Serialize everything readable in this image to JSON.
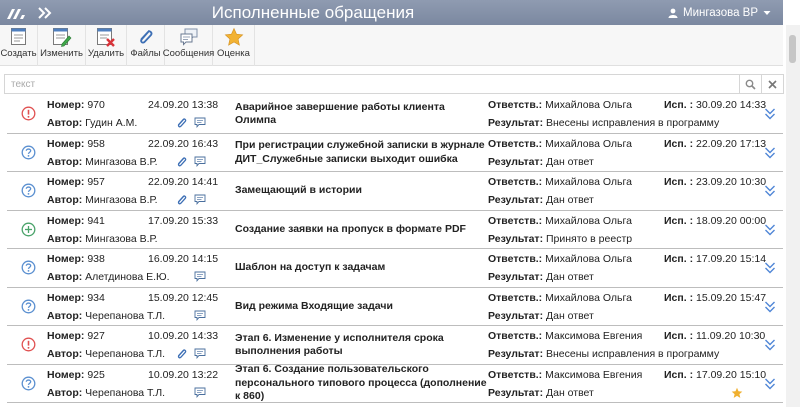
{
  "header": {
    "title": "Исполненные обращения",
    "user": "Мингазова ВР"
  },
  "toolbar": {
    "create": "Создать",
    "edit": "Изменить",
    "delete": "Удалить",
    "files": "Файлы",
    "messages": "Сообщения",
    "rating": "Оценка"
  },
  "search": {
    "placeholder": "текст"
  },
  "labels": {
    "number": "Номер:",
    "author": "Автор:",
    "responsible": "Ответств.:",
    "executed": "Исп. :",
    "result": "Результат:"
  },
  "colors": {
    "header_bg": "#7f8ca4",
    "status_red": "#e05050",
    "status_blue": "#5a8fd0",
    "status_green": "#4aa36a",
    "expand_blue": "#4f86d6",
    "star": "#f0b030"
  },
  "rows": [
    {
      "status_icon": "exclamation-circle-icon",
      "number": "970",
      "date": "24.09.20 13:38",
      "author": "Гудин А.М.",
      "clip": true,
      "msg": true,
      "subject": "Аварийное завершение работы клиента Олимпа",
      "responsible": "Михайлова Ольга",
      "executed": "30.09.20 14:33",
      "result": "Внесены исправления в программу",
      "star": false
    },
    {
      "status_icon": "question-circle-icon",
      "number": "958",
      "date": "22.09.20 16:43",
      "author": "Мингазова В.Р.",
      "clip": true,
      "msg": true,
      "subject": "При регистрации служебной записки в журнале ДИТ_Служебные записки выходит ошибка",
      "responsible": "Михайлова Ольга",
      "executed": "22.09.20 17:13",
      "result": "Дан ответ",
      "star": false
    },
    {
      "status_icon": "question-circle-icon",
      "number": "957",
      "date": "22.09.20 14:41",
      "author": "Мингазова В.Р.",
      "clip": true,
      "msg": true,
      "subject": "Замещающий в истории",
      "responsible": "Михайлова Ольга",
      "executed": "23.09.20 10:30",
      "result": "Дан ответ",
      "star": false
    },
    {
      "status_icon": "plus-circle-icon",
      "number": "941",
      "date": "17.09.20 15:33",
      "author": "Мингазова В.Р.",
      "clip": false,
      "msg": false,
      "subject": "Создание заявки на пропуск в формате PDF",
      "responsible": "Михайлова Ольга",
      "executed": "18.09.20 00:00",
      "result": "Принято в реестр",
      "star": false
    },
    {
      "status_icon": "question-circle-icon",
      "number": "938",
      "date": "16.09.20 14:15",
      "author": "Алетдинова Е.Ю.",
      "clip": false,
      "msg": true,
      "subject": "Шаблон на доступ к задачам",
      "responsible": "Михайлова Ольга",
      "executed": "17.09.20 15:14",
      "result": "Дан ответ",
      "star": false
    },
    {
      "status_icon": "question-circle-icon",
      "number": "934",
      "date": "15.09.20 12:45",
      "author": "Черепанова Т.Л.",
      "clip": false,
      "msg": true,
      "subject": "Вид режима Входящие задачи",
      "responsible": "Михайлова Ольга",
      "executed": "15.09.20 15:47",
      "result": "Дан ответ",
      "star": false
    },
    {
      "status_icon": "exclamation-circle-icon",
      "number": "927",
      "date": "10.09.20 14:33",
      "author": "Черепанова Т.Л.",
      "clip": true,
      "msg": true,
      "subject": "Этап 6. Изменение у исполнителя срока выполнения работы",
      "responsible": "Максимова Евгения",
      "executed": "11.09.20 10:30",
      "result": "Внесены исправления в программу",
      "star": false
    },
    {
      "status_icon": "question-circle-icon",
      "number": "925",
      "date": "10.09.20 13:22",
      "author": "Черепанова Т.Л.",
      "clip": false,
      "msg": true,
      "subject": "Этап 6. Создание пользовательского персонального типового процесса (дополнение к 860)",
      "responsible": "Максимова Евгения",
      "executed": "17.09.20 15:10",
      "result": "Дан ответ",
      "star": true
    }
  ]
}
